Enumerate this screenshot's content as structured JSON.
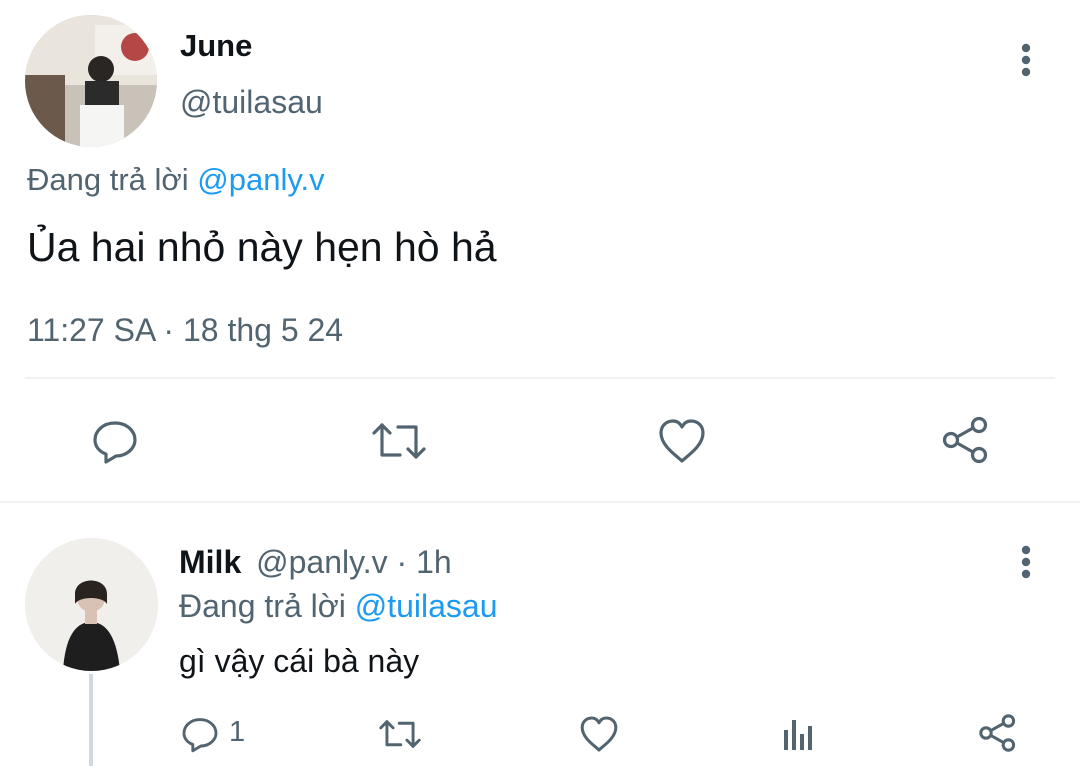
{
  "main_tweet": {
    "author_name": "June",
    "author_handle": "@tuilasau",
    "reply_prefix": "Đang trả lời",
    "reply_to": "@panly.v",
    "text": "Ủa hai nhỏ này hẹn hò hả",
    "timestamp": "11:27 SA · 18 thg 5 24",
    "actions": {
      "reply": "reply-icon",
      "retweet": "retweet-icon",
      "like": "heart-icon",
      "share": "share-icon"
    }
  },
  "reply_tweet": {
    "author_name": "Milk",
    "author_handle": "@panly.v",
    "time_sep": "·",
    "time_ago": "1h",
    "reply_prefix": "Đang trả lời",
    "reply_to": "@tuilasau",
    "text": "gì vậy cái bà này",
    "reply_count": "1"
  },
  "colors": {
    "link": "#1d9bf0",
    "muted": "#536471",
    "text": "#0f1419",
    "divider": "#eff3f4"
  }
}
